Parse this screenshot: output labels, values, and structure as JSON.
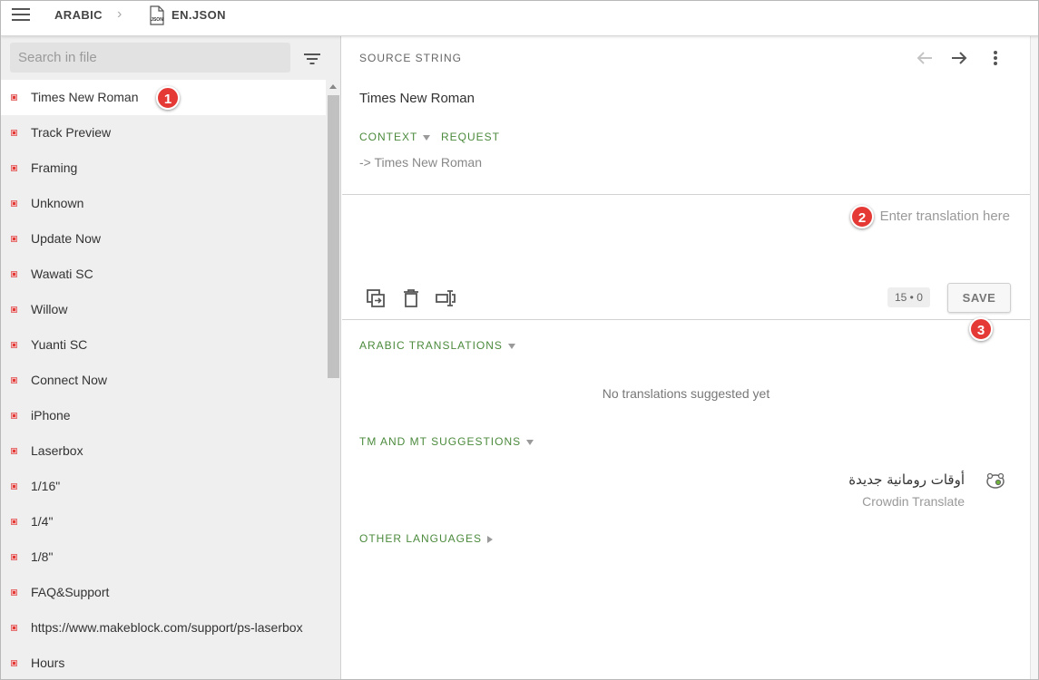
{
  "breadcrumb": {
    "project_lang": "ARABIC",
    "file_name": "EN.JSON",
    "file_icon_text": "JSON"
  },
  "sidebar": {
    "search_placeholder": "Search in file",
    "items": [
      {
        "label": "Times New Roman"
      },
      {
        "label": "Track Preview"
      },
      {
        "label": "Framing"
      },
      {
        "label": "Unknown"
      },
      {
        "label": "Update Now"
      },
      {
        "label": "Wawati SC"
      },
      {
        "label": "Willow"
      },
      {
        "label": "Yuanti SC"
      },
      {
        "label": "Connect Now"
      },
      {
        "label": "iPhone"
      },
      {
        "label": "Laserbox"
      },
      {
        "label": "1/16\""
      },
      {
        "label": "1/4\""
      },
      {
        "label": "1/8\""
      },
      {
        "label": "FAQ&Support"
      },
      {
        "label": "https://www.makeblock.com/support/ps-laserbox"
      },
      {
        "label": "Hours"
      }
    ]
  },
  "editor": {
    "source_header": "SOURCE STRING",
    "source_text": "Times New Roman",
    "context_label": "CONTEXT",
    "request_label": "REQUEST",
    "context_text": "-> Times New Roman",
    "translation_placeholder": "Enter translation here",
    "counter": "15 • 0",
    "save_label": "SAVE"
  },
  "sections": {
    "arabic_translations": "ARABIC TRANSLATIONS",
    "no_translations": "No translations suggested yet",
    "tm_mt": "TM AND MT SUGGESTIONS",
    "suggestion_text": "أوقات رومانية جديدة",
    "suggestion_source": "Crowdin Translate",
    "other_languages": "OTHER LANGUAGES"
  },
  "markers": [
    "1",
    "2",
    "3"
  ],
  "colors": {
    "accent_green": "#4b8a3c",
    "marker_red": "#e53935"
  }
}
